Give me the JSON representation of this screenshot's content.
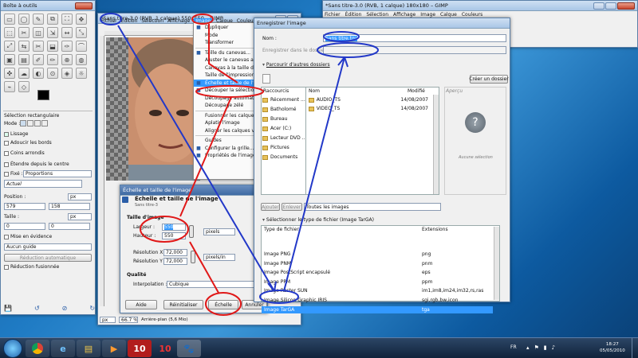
{
  "toolbox": {
    "title": "Boîte à outils",
    "option_title": "Sélection rectangulaire",
    "mode_label": "Mode :",
    "options": [
      "Lissage",
      "Adoucir les bords",
      "Coins arrondis",
      "Étendre depuis le centre"
    ],
    "fixed_label": "Fixé :",
    "fixed_value": "Proportions",
    "current_value": "Actuel",
    "position_label": "Position :",
    "pos_x": "579",
    "pos_y": "158",
    "unit": "px",
    "size_label": "Taille :",
    "size_w": "0",
    "size_h": "0",
    "highlight": "Mise en évidence",
    "guides": "Aucun guide",
    "auto_shrink": "Réduction automatique",
    "merged": "Réduction fusionnée"
  },
  "gimp": {
    "title": "*Sans titre-3.0 (RVB, 1 calque) 550x550 – GIMP",
    "menus": [
      "Fichier",
      "Édition",
      "Sélection",
      "Affichage",
      "Image",
      "Calque",
      "Couleurs"
    ],
    "status_unit": "px",
    "status_zoom": "66.7 %",
    "status_text": "Arrière-plan (5,6 Mio)"
  },
  "gimp2": {
    "title": "*Sans titre-3.0 (RVB, 1 calque) 180x180 – GIMP",
    "menus": [
      "Fichier",
      "Édition",
      "Sélection",
      "Affichage",
      "Image",
      "Calque",
      "Couleurs"
    ]
  },
  "image_menu": {
    "items": [
      {
        "icon": "duplicate-icon",
        "label": "Dupliquer"
      },
      {
        "icon": "",
        "label": "Mode"
      },
      {
        "icon": "",
        "label": "Transformer"
      },
      {
        "sep": true
      },
      {
        "icon": "canvas-size-icon",
        "label": "Taille du canevas..."
      },
      {
        "icon": "",
        "label": "Ajuster le canevas aux calques"
      },
      {
        "icon": "",
        "label": "Canevas à la taille de la sélection"
      },
      {
        "icon": "",
        "label": "Taille de l'impression..."
      },
      {
        "icon": "scale-image-icon",
        "label": "Échelle et taille de l'image..."
      },
      {
        "icon": "crop-icon",
        "label": "Découper la sélection"
      },
      {
        "icon": "",
        "label": "Découpage automatique"
      },
      {
        "icon": "",
        "label": "Découpage zélé"
      },
      {
        "sep": true
      },
      {
        "icon": "",
        "label": "Fusionner les calques visibles"
      },
      {
        "icon": "",
        "label": "Aplatir l'image"
      },
      {
        "icon": "",
        "label": "Aligner les calques visibles"
      },
      {
        "sep": true
      },
      {
        "icon": "",
        "label": "Guides"
      },
      {
        "icon": "grid-icon",
        "label": "Configurer la grille..."
      },
      {
        "icon": "properties-icon",
        "label": "Propriétés de l'image"
      }
    ]
  },
  "scale_dialog": {
    "title": "Échelle et taille de l'image",
    "subtitle": "Sans titre-3",
    "image_size": "Taille d'image",
    "width_label": "Largeur :",
    "width_value": "550",
    "height_label": "Hauteur :",
    "height_value": "550",
    "size_unit": "pixels",
    "resx_label": "Résolution X :",
    "resx_value": "72,000",
    "resy_label": "Résolution Y :",
    "resy_value": "72,000",
    "res_unit": "pixels/in",
    "quality": "Qualité",
    "interp_label": "Interpolation :",
    "interp_value": "Cubique",
    "help": "Aide",
    "reset": "Réinitialiser",
    "scale": "Échelle",
    "cancel": "Annuler"
  },
  "save_dialog": {
    "title": "Enregistrer l'image",
    "name_label": "Nom :",
    "name_value": "Sans titre.tga",
    "folder_label": "Enregistrer dans le dossier :",
    "browse": "Parcourir d'autres dossiers",
    "create_folder": "Créer un dossier",
    "places_header": "Raccourcis",
    "places": [
      "Récemment ...",
      "Batholomé",
      "Bureau",
      "Acer (C:)",
      "Lecteur DVD ...",
      "Pictures",
      "Documents"
    ],
    "col_name": "Nom",
    "col_modified": "Modifié",
    "preview_header": "Aperçu",
    "no_selection": "Aucune sélection",
    "files": [
      {
        "name": "AUDIO_TS",
        "date": "14/08/2007"
      },
      {
        "name": "VIDEO_TS",
        "date": "14/08/2007"
      }
    ],
    "add": "Ajouter",
    "remove": "Enlever",
    "filter": "Toutes les images",
    "select_type": "Sélectionner le type de fichier (Image TarGA)",
    "type_col": "Type de fichier",
    "ext_col": "Extensions",
    "types": [
      {
        "type": "Image PNG",
        "ext": "png"
      },
      {
        "type": "Image PNM",
        "ext": "pnm"
      },
      {
        "type": "Image PostScript encapsulé",
        "ext": "eps"
      },
      {
        "type": "Image PPM",
        "ext": "ppm"
      },
      {
        "type": "Image Raster SUN",
        "ext": "im1,im8,im24,im32,rs,ras"
      },
      {
        "type": "Image Silicon Graphic IRIS",
        "ext": "sgi,rgb,bw,icon"
      },
      {
        "type": "Image TarGA",
        "ext": "tga"
      }
    ]
  },
  "taskbar": {
    "lang": "FR",
    "time": "18:27",
    "date": "05/05/2010",
    "badge": "10"
  },
  "colors": {
    "annotation_red": "#e01818",
    "annotation_blue": "#2238c8",
    "selection": "#3399ff"
  }
}
